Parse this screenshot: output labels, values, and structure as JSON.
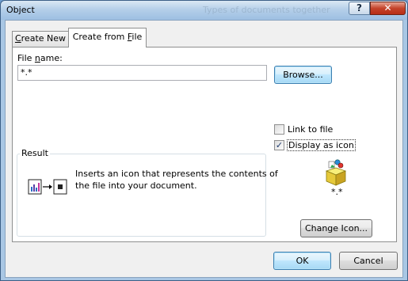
{
  "window": {
    "title": "Object",
    "background_title": "Types of documents together",
    "help_label": "?",
    "close_label": "✕"
  },
  "tabs": [
    {
      "label": "Create New",
      "accel": "C",
      "rest": "reate New"
    },
    {
      "label": "Create from File",
      "pre": "Create from ",
      "accel": "F",
      "rest": "ile"
    }
  ],
  "file": {
    "label_pre": "File ",
    "label_accel": "n",
    "label_rest": "ame:",
    "label": "File name:",
    "value": "*.*",
    "browse_label": "Browse..."
  },
  "options": {
    "link_to_file": {
      "label": "Link to file",
      "accel": "k",
      "checked": false
    },
    "display_as_icon": {
      "label": "Display as icon",
      "accel": "a",
      "checked": true
    }
  },
  "icon_preview": {
    "caption": "*.*",
    "icon_name": "package-box-icon"
  },
  "change_icon_label": "Change Icon...",
  "result": {
    "legend": "Result",
    "text": "Inserts an icon that represents the contents of the file into your document.",
    "line1": "Inserts an icon that represents the contents of",
    "line2": "the file into your document.",
    "icon_name": "embed-icon-diagram"
  },
  "footer": {
    "ok_label": "OK",
    "cancel_label": "Cancel"
  }
}
